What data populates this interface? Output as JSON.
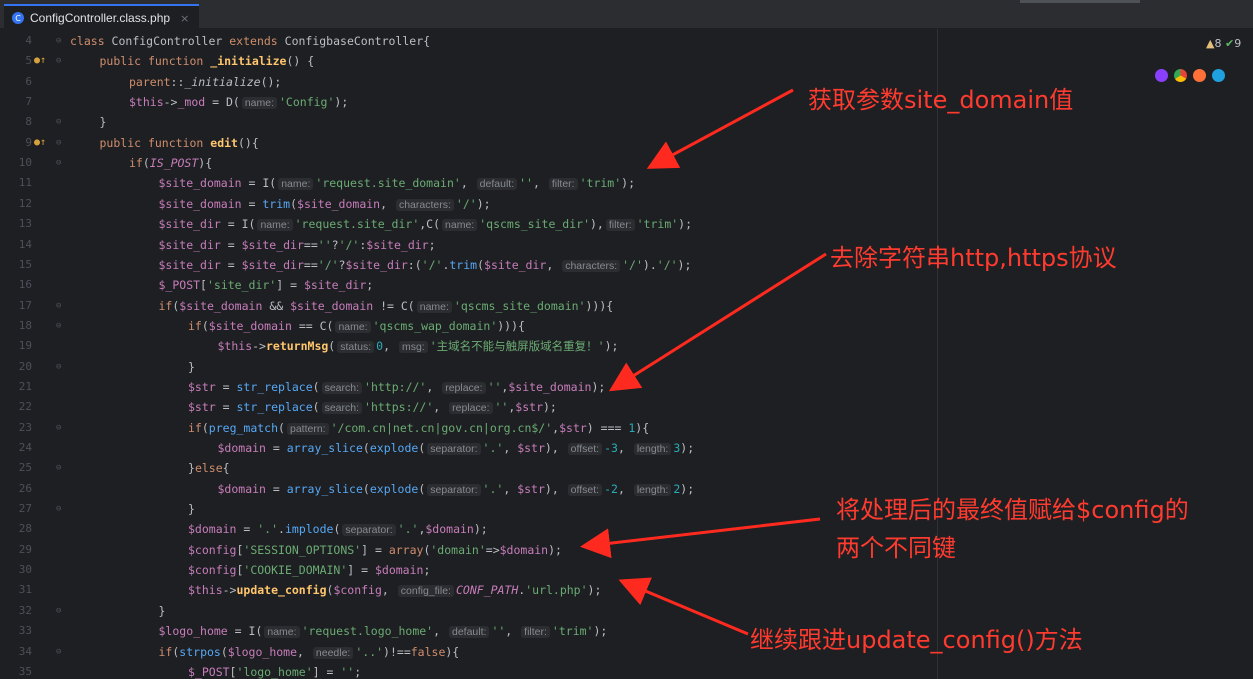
{
  "tab": {
    "icon": "C",
    "filename": "ConfigController.class.php",
    "close": "×"
  },
  "inspections": {
    "warning_icon": "warning-triangle-icon",
    "warnings": "8",
    "ok_icon": "check-icon",
    "ok_count": "9"
  },
  "browsers": [
    "phpstorm-icon",
    "chrome-icon",
    "firefox-icon",
    "edge-icon"
  ],
  "annotations": {
    "a1": "获取参数site_domain值",
    "a2": "去除字符串http,https协议",
    "a3_line1": "将处理后的最终值赋给$config的",
    "a3_line2": "两个不同键",
    "a4": "继续跟进update_config()方法"
  },
  "lines": [
    {
      "n": "4",
      "mark": "",
      "fold": "⊖",
      "indent": 0,
      "tokens": [
        [
          "kw",
          "class "
        ],
        [
          "plain",
          "ConfigController "
        ],
        [
          "kw",
          "extends "
        ],
        [
          "plain",
          "ConfigbaseController{"
        ]
      ]
    },
    {
      "n": "5",
      "mark": "●↑",
      "fold": "⊖",
      "indent": 1,
      "tokens": [
        [
          "kw",
          "public function "
        ],
        [
          "fnb",
          "_initialize"
        ],
        [
          "plain",
          "() {"
        ]
      ]
    },
    {
      "n": "6",
      "mark": "",
      "fold": "",
      "indent": 2,
      "tokens": [
        [
          "kw",
          "parent"
        ],
        [
          "plain",
          "::"
        ],
        [
          "it",
          "_initialize"
        ],
        [
          "plain",
          "();"
        ]
      ]
    },
    {
      "n": "7",
      "mark": "",
      "fold": "",
      "indent": 2,
      "tokens": [
        [
          "var",
          "$this"
        ],
        [
          "plain",
          "->"
        ],
        [
          "var",
          "_mod"
        ],
        [
          "plain",
          " = D("
        ],
        [
          "hint",
          "name:"
        ],
        [
          "str",
          "'Config'"
        ],
        [
          "plain",
          ");"
        ]
      ]
    },
    {
      "n": "8",
      "mark": "",
      "fold": "⊖",
      "indent": 1,
      "tokens": [
        [
          "plain",
          "}"
        ]
      ]
    },
    {
      "n": "9",
      "mark": "●↑",
      "fold": "⊖",
      "indent": 1,
      "tokens": [
        [
          "kw",
          "public function "
        ],
        [
          "fnb",
          "edit"
        ],
        [
          "plain",
          "(){"
        ]
      ]
    },
    {
      "n": "10",
      "mark": "",
      "fold": "⊖",
      "indent": 2,
      "tokens": [
        [
          "kw",
          "if"
        ],
        [
          "plain",
          "("
        ],
        [
          "const",
          "IS_POST"
        ],
        [
          "plain",
          "){"
        ]
      ]
    },
    {
      "n": "11",
      "mark": "",
      "fold": "",
      "indent": 3,
      "tokens": [
        [
          "var",
          "$site_domain"
        ],
        [
          "plain",
          " = I("
        ],
        [
          "hint",
          "name:"
        ],
        [
          "str",
          "'request.site_domain'"
        ],
        [
          "plain",
          ", "
        ],
        [
          "hint",
          "default:"
        ],
        [
          "str",
          "''"
        ],
        [
          "plain",
          ", "
        ],
        [
          "hint",
          "filter:"
        ],
        [
          "str",
          "'trim'"
        ],
        [
          "plain",
          ");"
        ]
      ]
    },
    {
      "n": "12",
      "mark": "",
      "fold": "",
      "indent": 3,
      "tokens": [
        [
          "var",
          "$site_domain"
        ],
        [
          "plain",
          " = "
        ],
        [
          "fn",
          "trim"
        ],
        [
          "plain",
          "("
        ],
        [
          "var",
          "$site_domain"
        ],
        [
          "plain",
          ", "
        ],
        [
          "hint",
          "characters:"
        ],
        [
          "str",
          "'/'"
        ],
        [
          "plain",
          ");"
        ]
      ]
    },
    {
      "n": "13",
      "mark": "",
      "fold": "",
      "indent": 3,
      "tokens": [
        [
          "var",
          "$site_dir"
        ],
        [
          "plain",
          " = I("
        ],
        [
          "hint",
          "name:"
        ],
        [
          "str",
          "'request.site_dir'"
        ],
        [
          "plain",
          ",C("
        ],
        [
          "hint",
          "name:"
        ],
        [
          "str",
          "'qscms_site_dir'"
        ],
        [
          "plain",
          "),"
        ],
        [
          "hint",
          "filter:"
        ],
        [
          "str",
          "'trim'"
        ],
        [
          "plain",
          ");"
        ]
      ]
    },
    {
      "n": "14",
      "mark": "",
      "fold": "",
      "indent": 3,
      "tokens": [
        [
          "var",
          "$site_dir"
        ],
        [
          "plain",
          " = "
        ],
        [
          "var",
          "$site_dir"
        ],
        [
          "plain",
          "=="
        ],
        [
          "str",
          "''"
        ],
        [
          "plain",
          "?"
        ],
        [
          "str",
          "'/'"
        ],
        [
          "plain",
          ":"
        ],
        [
          "var",
          "$site_dir"
        ],
        [
          "plain",
          ";"
        ]
      ]
    },
    {
      "n": "15",
      "mark": "",
      "fold": "",
      "indent": 3,
      "tokens": [
        [
          "var",
          "$site_dir"
        ],
        [
          "plain",
          " = "
        ],
        [
          "var",
          "$site_dir"
        ],
        [
          "plain",
          "=="
        ],
        [
          "str",
          "'/'"
        ],
        [
          "plain",
          "?"
        ],
        [
          "var",
          "$site_dir"
        ],
        [
          "plain",
          ":("
        ],
        [
          "str",
          "'/'"
        ],
        [
          "plain",
          "."
        ],
        [
          "fn",
          "trim"
        ],
        [
          "plain",
          "("
        ],
        [
          "var",
          "$site_dir"
        ],
        [
          "plain",
          ", "
        ],
        [
          "hint",
          "characters:"
        ],
        [
          "str",
          "'/'"
        ],
        [
          "plain",
          ")."
        ],
        [
          "str",
          "'/'"
        ],
        [
          "plain",
          ");"
        ]
      ]
    },
    {
      "n": "16",
      "mark": "",
      "fold": "",
      "indent": 3,
      "tokens": [
        [
          "var",
          "$_POST"
        ],
        [
          "plain",
          "["
        ],
        [
          "str",
          "'site_dir'"
        ],
        [
          "plain",
          "] = "
        ],
        [
          "var",
          "$site_dir"
        ],
        [
          "plain",
          ";"
        ]
      ]
    },
    {
      "n": "17",
      "mark": "",
      "fold": "⊖",
      "indent": 3,
      "tokens": [
        [
          "kw",
          "if"
        ],
        [
          "plain",
          "("
        ],
        [
          "var",
          "$site_domain"
        ],
        [
          "plain",
          " && "
        ],
        [
          "var",
          "$site_domain"
        ],
        [
          "plain",
          " != C("
        ],
        [
          "hint",
          "name:"
        ],
        [
          "str",
          "'qscms_site_domain'"
        ],
        [
          "plain",
          "))){"
        ]
      ]
    },
    {
      "n": "18",
      "mark": "",
      "fold": "⊖",
      "indent": 4,
      "tokens": [
        [
          "kw",
          "if"
        ],
        [
          "plain",
          "("
        ],
        [
          "var",
          "$site_domain"
        ],
        [
          "plain",
          " == C("
        ],
        [
          "hint",
          "name:"
        ],
        [
          "str",
          "'qscms_wap_domain'"
        ],
        [
          "plain",
          "))){"
        ]
      ]
    },
    {
      "n": "19",
      "mark": "",
      "fold": "",
      "indent": 5,
      "tokens": [
        [
          "var",
          "$this"
        ],
        [
          "plain",
          "->"
        ],
        [
          "fnb",
          "returnMsg"
        ],
        [
          "plain",
          "("
        ],
        [
          "hint",
          "status:"
        ],
        [
          "num",
          "0"
        ],
        [
          "plain",
          ", "
        ],
        [
          "hint",
          "msg:"
        ],
        [
          "str",
          "'主域名不能与触屏版域名重复！'"
        ],
        [
          "plain",
          ");"
        ]
      ]
    },
    {
      "n": "20",
      "mark": "",
      "fold": "⊖",
      "indent": 4,
      "tokens": [
        [
          "plain",
          "}"
        ]
      ]
    },
    {
      "n": "21",
      "mark": "",
      "fold": "",
      "indent": 4,
      "tokens": [
        [
          "var",
          "$str"
        ],
        [
          "plain",
          " = "
        ],
        [
          "fn",
          "str_replace"
        ],
        [
          "plain",
          "("
        ],
        [
          "hint",
          "search:"
        ],
        [
          "str",
          "'http://'"
        ],
        [
          "plain",
          ", "
        ],
        [
          "hint",
          "replace:"
        ],
        [
          "str",
          "''"
        ],
        [
          "plain",
          ","
        ],
        [
          "var",
          "$site_domain"
        ],
        [
          "plain",
          ");"
        ]
      ]
    },
    {
      "n": "22",
      "mark": "",
      "fold": "",
      "indent": 4,
      "tokens": [
        [
          "var",
          "$str"
        ],
        [
          "plain",
          " = "
        ],
        [
          "fn",
          "str_replace"
        ],
        [
          "plain",
          "("
        ],
        [
          "hint",
          "search:"
        ],
        [
          "str",
          "'https://'"
        ],
        [
          "plain",
          ", "
        ],
        [
          "hint",
          "replace:"
        ],
        [
          "str",
          "''"
        ],
        [
          "plain",
          ","
        ],
        [
          "var",
          "$str"
        ],
        [
          "plain",
          ");"
        ]
      ]
    },
    {
      "n": "23",
      "mark": "",
      "fold": "⊖",
      "indent": 4,
      "tokens": [
        [
          "kw",
          "if"
        ],
        [
          "plain",
          "("
        ],
        [
          "fn",
          "preg_match"
        ],
        [
          "plain",
          "("
        ],
        [
          "hint",
          "pattern:"
        ],
        [
          "str",
          "'/com.cn|net.cn|gov.cn|org.cn$/'"
        ],
        [
          "plain",
          ","
        ],
        [
          "var",
          "$str"
        ],
        [
          "plain",
          ") === "
        ],
        [
          "num",
          "1"
        ],
        [
          "plain",
          "){"
        ]
      ]
    },
    {
      "n": "24",
      "mark": "",
      "fold": "",
      "indent": 5,
      "tokens": [
        [
          "var",
          "$domain"
        ],
        [
          "plain",
          " = "
        ],
        [
          "fn",
          "array_slice"
        ],
        [
          "plain",
          "("
        ],
        [
          "fn",
          "explode"
        ],
        [
          "plain",
          "("
        ],
        [
          "hint",
          "separator:"
        ],
        [
          "str",
          "'.'"
        ],
        [
          "plain",
          ", "
        ],
        [
          "var",
          "$str"
        ],
        [
          "plain",
          "), "
        ],
        [
          "hint",
          "offset:"
        ],
        [
          "num",
          "-3"
        ],
        [
          "plain",
          ", "
        ],
        [
          "hint",
          "length:"
        ],
        [
          "num",
          "3"
        ],
        [
          "plain",
          ");"
        ]
      ]
    },
    {
      "n": "25",
      "mark": "",
      "fold": "⊖",
      "indent": 4,
      "tokens": [
        [
          "plain",
          "}"
        ],
        [
          "kw",
          "else"
        ],
        [
          "plain",
          "{"
        ]
      ]
    },
    {
      "n": "26",
      "mark": "",
      "fold": "",
      "indent": 5,
      "tokens": [
        [
          "var",
          "$domain"
        ],
        [
          "plain",
          " = "
        ],
        [
          "fn",
          "array_slice"
        ],
        [
          "plain",
          "("
        ],
        [
          "fn",
          "explode"
        ],
        [
          "plain",
          "("
        ],
        [
          "hint",
          "separator:"
        ],
        [
          "str",
          "'.'"
        ],
        [
          "plain",
          ", "
        ],
        [
          "var",
          "$str"
        ],
        [
          "plain",
          "), "
        ],
        [
          "hint",
          "offset:"
        ],
        [
          "num",
          "-2"
        ],
        [
          "plain",
          ", "
        ],
        [
          "hint",
          "length:"
        ],
        [
          "num",
          "2"
        ],
        [
          "plain",
          ");"
        ]
      ]
    },
    {
      "n": "27",
      "mark": "",
      "fold": "⊖",
      "indent": 4,
      "tokens": [
        [
          "plain",
          "}"
        ]
      ]
    },
    {
      "n": "28",
      "mark": "",
      "fold": "",
      "indent": 4,
      "tokens": [
        [
          "var",
          "$domain"
        ],
        [
          "plain",
          " = "
        ],
        [
          "str",
          "'.'"
        ],
        [
          "plain",
          "."
        ],
        [
          "fn",
          "implode"
        ],
        [
          "plain",
          "("
        ],
        [
          "hint",
          "separator:"
        ],
        [
          "str",
          "'.'"
        ],
        [
          "plain",
          ","
        ],
        [
          "var",
          "$domain"
        ],
        [
          "plain",
          ");"
        ]
      ]
    },
    {
      "n": "29",
      "mark": "",
      "fold": "",
      "indent": 4,
      "tokens": [
        [
          "var",
          "$config"
        ],
        [
          "plain",
          "["
        ],
        [
          "str",
          "'SESSION_OPTIONS'"
        ],
        [
          "plain",
          "] = "
        ],
        [
          "kw",
          "array"
        ],
        [
          "plain",
          "("
        ],
        [
          "str",
          "'domain'"
        ],
        [
          "plain",
          "=>"
        ],
        [
          "var",
          "$domain"
        ],
        [
          "plain",
          ");"
        ]
      ]
    },
    {
      "n": "30",
      "mark": "",
      "fold": "",
      "indent": 4,
      "tokens": [
        [
          "var",
          "$config"
        ],
        [
          "plain",
          "["
        ],
        [
          "str",
          "'COOKIE_DOMAIN'"
        ],
        [
          "plain",
          "] = "
        ],
        [
          "var",
          "$domain"
        ],
        [
          "plain",
          ";"
        ]
      ]
    },
    {
      "n": "31",
      "mark": "",
      "fold": "",
      "indent": 4,
      "tokens": [
        [
          "var",
          "$this"
        ],
        [
          "plain",
          "->"
        ],
        [
          "fnb",
          "update_config"
        ],
        [
          "plain",
          "("
        ],
        [
          "var",
          "$config"
        ],
        [
          "plain",
          ", "
        ],
        [
          "hint",
          "config_file:"
        ],
        [
          "const",
          "CONF_PATH"
        ],
        [
          "plain",
          "."
        ],
        [
          "str",
          "'url.php'"
        ],
        [
          "plain",
          ");"
        ]
      ]
    },
    {
      "n": "32",
      "mark": "",
      "fold": "⊖",
      "indent": 3,
      "tokens": [
        [
          "plain",
          "}"
        ]
      ]
    },
    {
      "n": "33",
      "mark": "",
      "fold": "",
      "indent": 3,
      "tokens": [
        [
          "var",
          "$logo_home"
        ],
        [
          "plain",
          " = I("
        ],
        [
          "hint",
          "name:"
        ],
        [
          "str",
          "'request.logo_home'"
        ],
        [
          "plain",
          ", "
        ],
        [
          "hint",
          "default:"
        ],
        [
          "str",
          "''"
        ],
        [
          "plain",
          ", "
        ],
        [
          "hint",
          "filter:"
        ],
        [
          "str",
          "'trim'"
        ],
        [
          "plain",
          ");"
        ]
      ]
    },
    {
      "n": "34",
      "mark": "",
      "fold": "⊖",
      "indent": 3,
      "tokens": [
        [
          "kw",
          "if"
        ],
        [
          "plain",
          "("
        ],
        [
          "fn",
          "strpos"
        ],
        [
          "plain",
          "("
        ],
        [
          "var",
          "$logo_home"
        ],
        [
          "plain",
          ", "
        ],
        [
          "hint",
          "needle:"
        ],
        [
          "str",
          "'..'"
        ],
        [
          "plain",
          ")!=="
        ],
        [
          "kw",
          "false"
        ],
        [
          "plain",
          "){"
        ]
      ]
    },
    {
      "n": "35",
      "mark": "",
      "fold": "",
      "indent": 4,
      "tokens": [
        [
          "var",
          "$_POST"
        ],
        [
          "plain",
          "["
        ],
        [
          "str",
          "'logo_home'"
        ],
        [
          "plain",
          "] = "
        ],
        [
          "str",
          "''"
        ],
        [
          "plain",
          ";"
        ]
      ]
    }
  ]
}
